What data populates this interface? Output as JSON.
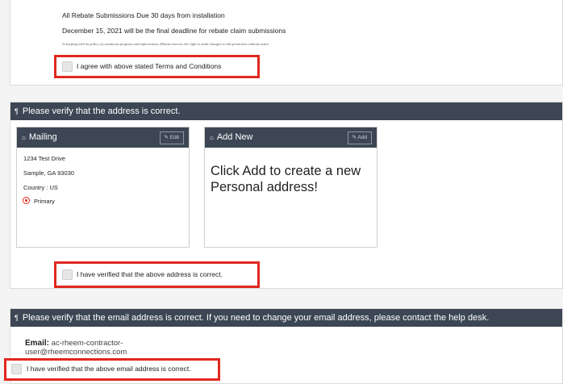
{
  "terms": {
    "line1": "All Rebate Submissions Due 30 days from installation",
    "line2": "December 15, 2021 will be the final deadline for rebate claim submissions",
    "fine_print": "In keeping with its policy of continuous progress and improvement, Rheem reserves the right to make changes to this promotion without notice.",
    "agree_label": "I agree with above stated Terms and Conditions"
  },
  "address_section": {
    "header": "Please verify that the address is correct.",
    "mailing": {
      "title": "Mailing",
      "edit_label": "Edit",
      "street": "1234 Test Drive",
      "city_line": "Sample, GA 93030",
      "country_line": "Country : US",
      "primary_label": "Primary"
    },
    "add_new": {
      "title": "Add New",
      "add_label": "Add",
      "message": "Click Add to create a new Personal address!"
    },
    "verify_label": "I have verified that the above address is correct."
  },
  "email_section": {
    "header": "Please verify that the email address is correct. If you need to change your email address, please contact the help desk.",
    "email_label": "Email:",
    "email_value": "ac-rheem-contractor-user@rheemconnections.com",
    "verify_label": "I have verified that the above email address is correct."
  },
  "colors": {
    "header_bg": "#3c4654",
    "highlight": "#e0281f",
    "page_bg": "#f4f4f4"
  }
}
